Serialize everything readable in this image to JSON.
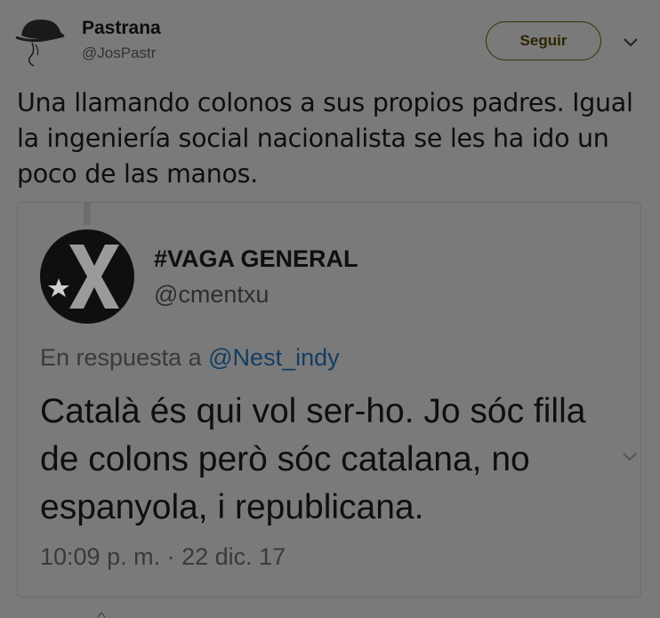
{
  "author": {
    "display_name": "Pastrana",
    "handle": "@JosPastr",
    "avatar_icon": "hat-sketch-avatar"
  },
  "follow_button": {
    "label": "Seguir"
  },
  "menu_icon": "chevron-down-icon",
  "tweet": {
    "text": "Una llamando colonos a sus propios padres. Igual la ingeniería social nacionalista se les ha ido un poco de las manos."
  },
  "quoted": {
    "display_name": "#VAGA GENERAL",
    "handle": "@cmentxu",
    "avatar_icon": "star-cross-avatar",
    "reply_prefix": "En respuesta a",
    "reply_mention": "@Nest_indy",
    "text": "Català és qui vol ser-ho. Jo sóc filla de colons però sóc catalana, no espanyola, i republicana.",
    "timestamp": "10:09 p. m. · 22 dic. 17"
  },
  "colors": {
    "background": "#7a7a7a",
    "text": "#0e0e0e",
    "mention": "#123d63",
    "follow_border": "#3a2f00"
  }
}
